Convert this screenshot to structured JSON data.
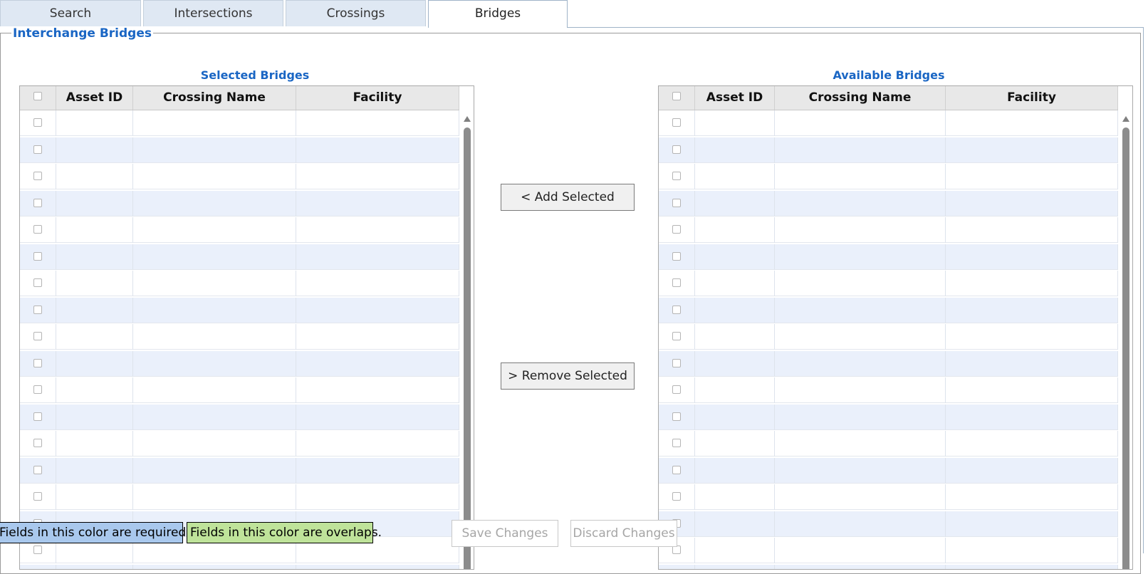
{
  "tabs": [
    {
      "label": "Search"
    },
    {
      "label": "Intersections"
    },
    {
      "label": "Crossings"
    },
    {
      "label": "Bridges"
    }
  ],
  "active_tab": "Bridges",
  "fieldset_legend": "Interchange Bridges",
  "selected_grid": {
    "title": "Selected Bridges",
    "columns": [
      "Asset ID",
      "Crossing Name",
      "Facility"
    ],
    "rows": []
  },
  "available_grid": {
    "title": "Available Bridges",
    "columns": [
      "Asset ID",
      "Crossing Name",
      "Facility"
    ],
    "rows": []
  },
  "buttons": {
    "add_selected": "< Add Selected",
    "remove_selected": "> Remove Selected",
    "save_changes": "Save Changes",
    "discard_changes": "Discard Changes"
  },
  "legend_notes": {
    "required": "Fields in this color are required.",
    "overlaps": "Fields in this color are overlaps."
  },
  "colors": {
    "accent_blue": "#1a66c4",
    "required_color": "#a9c8ed",
    "overlap_color": "#bfe39a",
    "row_alt": "#eaf0fb"
  }
}
